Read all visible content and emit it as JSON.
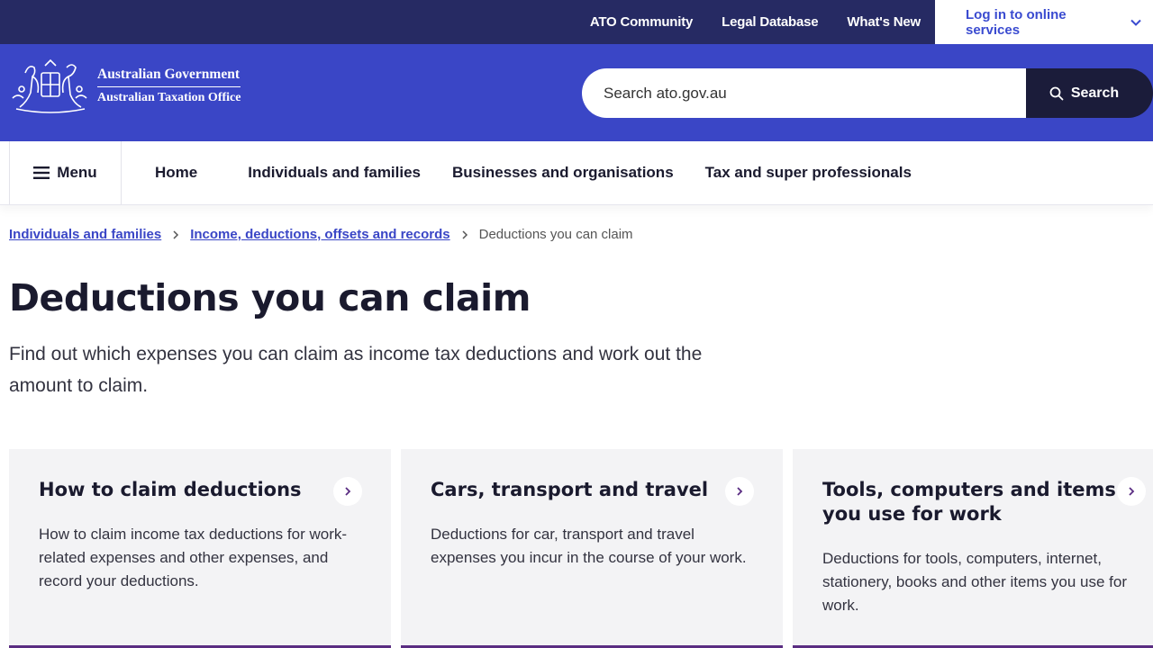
{
  "utility": {
    "links": [
      "ATO Community",
      "Legal Database",
      "What's New"
    ],
    "login_label": "Log in to online services"
  },
  "logo": {
    "line1": "Australian Government",
    "line2": "Australian Taxation Office"
  },
  "search": {
    "placeholder": "Search ato.gov.au",
    "button_label": "Search"
  },
  "nav": {
    "menu_label": "Menu",
    "items": [
      "Home",
      "Individuals and families",
      "Businesses and organisations",
      "Tax and super professionals"
    ]
  },
  "breadcrumb": {
    "items": [
      "Individuals and families",
      "Income, deductions, offsets and records"
    ],
    "current": "Deductions you can claim"
  },
  "page": {
    "title": "Deductions you can claim",
    "intro": "Find out which expenses you can claim as income tax deductions and work out the amount to claim."
  },
  "cards": [
    {
      "title": "How to claim deductions",
      "description": "How to claim income tax deductions for work-related expenses and other expenses, and record your deductions."
    },
    {
      "title": "Cars, transport and travel",
      "description": "Deductions for car, transport and travel expenses you incur in the course of your work."
    },
    {
      "title": "Tools, computers and items you use for work",
      "description": "Deductions for tools, computers, internet, stationery, books and other items you use for work."
    }
  ],
  "colors": {
    "utility_bar": "#262a63",
    "header": "#3a46c6",
    "search_button": "#1b1c3a",
    "link": "#3a46c6",
    "card_accent": "#5a2d82"
  }
}
